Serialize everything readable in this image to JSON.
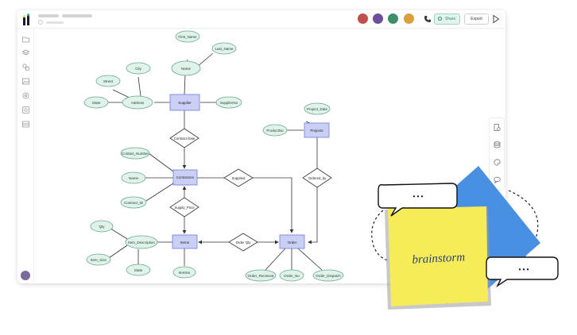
{
  "header": {
    "share_label": "Share",
    "export_label": "Export"
  },
  "icons": {
    "logo": "app-logo-icon",
    "phone": "phone-icon",
    "play": "present-play-icon",
    "sidebar": [
      "folder-icon",
      "layers-icon",
      "shapes-icon",
      "image-icon",
      "settings-icon",
      "integrations-icon",
      "table-icon"
    ],
    "right_panel": [
      "page-settings-icon",
      "database-icon",
      "palette-icon",
      "comment-icon"
    ]
  },
  "diagram": {
    "entities": {
      "supplier": "Supplier",
      "project": "Projects",
      "contractors": "Contractors",
      "items": "Items",
      "order": "Order"
    },
    "relationships": {
      "contract_date": "Contract Date",
      "supplied": "Supplied",
      "ordered_by": "Ordered_by",
      "supply_price": "Supply_Price",
      "order_qty": "Order Qty"
    },
    "attributes": {
      "first_name": "First_Name",
      "last_name": "Last_Name",
      "name_supplier": "Name",
      "city": "City",
      "street": "Street",
      "state_supplier": "State",
      "address": "Address",
      "supplier_no": "SupplierNo",
      "project_date": "Project_Date",
      "product_no": "ProductNo",
      "contact_number": "Contact_Number",
      "name_contractor": "Name",
      "contract_id": "Contract_ID",
      "qty": "Qty",
      "item_description": "Item_Description",
      "item_size": "Item_Size",
      "state_item": "State",
      "item_no": "ItemNo",
      "order_received": "Order_Received",
      "order_no": "Order_No",
      "order_dispatch": "Order_Dispatch"
    }
  },
  "sticky_note": {
    "text": "brainstorm",
    "ellipsis": "• • •"
  },
  "colors": {
    "entity_fill": "#c9cff5",
    "entity_stroke": "#6f7bd6",
    "attribute_fill": "#dff3ea",
    "attribute_stroke": "#6aa590",
    "share_green": "#2f8a6c",
    "sticky_yellow": "#f6ec5a",
    "sticky_blue": "#4a90e2"
  }
}
